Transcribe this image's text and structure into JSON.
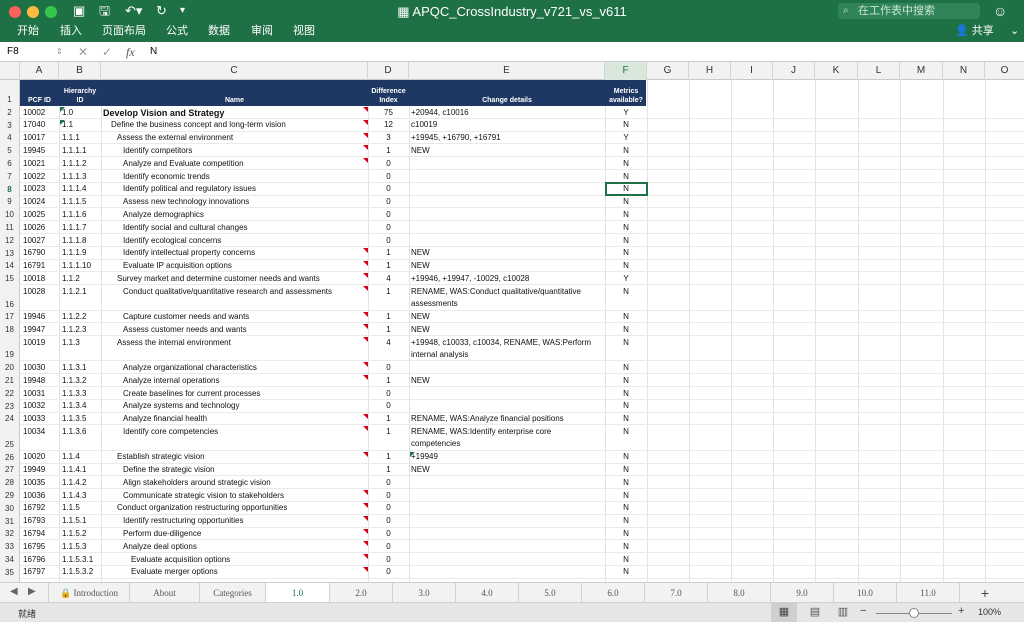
{
  "window": {
    "title": "APQC_CrossIndustry_v721_vs_v611",
    "search_placeholder": "在工作表中搜索",
    "share_label": "共享"
  },
  "menu": [
    "开始",
    "插入",
    "页面布局",
    "公式",
    "数据",
    "审阅",
    "视图"
  ],
  "formula_bar": {
    "cell_ref": "F8",
    "fx_label": "fx",
    "value": "N"
  },
  "columns": [
    "A",
    "B",
    "C",
    "D",
    "E",
    "F",
    "G",
    "H",
    "I",
    "J",
    "K",
    "L",
    "M",
    "N",
    "O"
  ],
  "header_row": {
    "a": "PCF ID",
    "b1": "Hierarchy",
    "b2": "ID",
    "c": "Name",
    "d1": "Difference",
    "d2": "Index",
    "e": "Change details",
    "f1": "Metrics",
    "f2": "available?"
  },
  "rows": [
    {
      "n": "2",
      "a": "10002",
      "b": "1.0",
      "c": "Develop Vision and Strategy",
      "d": "75",
      "e": "+20944, c10016",
      "f": "Y"
    },
    {
      "n": "3",
      "a": "17040",
      "b": "1.1",
      "c": "Define the business concept and long-term vision",
      "d": "12",
      "e": "c10019",
      "f": "N"
    },
    {
      "n": "4",
      "a": "10017",
      "b": "1.1.1",
      "c": "Assess the external environment",
      "d": "3",
      "e": "+19945, +16790, +16791",
      "f": "Y"
    },
    {
      "n": "5",
      "a": "19945",
      "b": "1.1.1.1",
      "c": "Identify competitors",
      "d": "1",
      "e": "NEW",
      "f": "N"
    },
    {
      "n": "6",
      "a": "10021",
      "b": "1.1.1.2",
      "c": "Analyze and Evaluate competition",
      "d": "0",
      "e": "",
      "f": "N"
    },
    {
      "n": "7",
      "a": "10022",
      "b": "1.1.1.3",
      "c": "Identify economic trends",
      "d": "0",
      "e": "",
      "f": "N"
    },
    {
      "n": "8",
      "a": "10023",
      "b": "1.1.1.4",
      "c": "Identify political and regulatory issues",
      "d": "0",
      "e": "",
      "f": "N"
    },
    {
      "n": "9",
      "a": "10024",
      "b": "1.1.1.5",
      "c": "Assess new technology innovations",
      "d": "0",
      "e": "",
      "f": "N"
    },
    {
      "n": "10",
      "a": "10025",
      "b": "1.1.1.6",
      "c": "Analyze demographics",
      "d": "0",
      "e": "",
      "f": "N"
    },
    {
      "n": "11",
      "a": "10026",
      "b": "1.1.1.7",
      "c": "Identify social and cultural changes",
      "d": "0",
      "e": "",
      "f": "N"
    },
    {
      "n": "12",
      "a": "10027",
      "b": "1.1.1.8",
      "c": "Identify ecological concerns",
      "d": "0",
      "e": "",
      "f": "N"
    },
    {
      "n": "13",
      "a": "16790",
      "b": "1.1.1.9",
      "c": "Identify intellectual property concerns",
      "d": "1",
      "e": "NEW",
      "f": "N"
    },
    {
      "n": "14",
      "a": "16791",
      "b": "1.1.1.10",
      "c": "Evaluate IP acquisition options",
      "d": "1",
      "e": "NEW",
      "f": "N"
    },
    {
      "n": "15",
      "a": "10018",
      "b": "1.1.2",
      "c": "Survey market and determine customer needs and wants",
      "d": "4",
      "e": "+19946, +19947, -10029, c10028",
      "f": "Y"
    },
    {
      "n": "16",
      "a": "10028",
      "b": "1.1.2.1",
      "c": "Conduct qualitative/quantitative research and assessments",
      "d": "1",
      "e": "RENAME, WAS:Conduct qualitative/quantitative",
      "e2": "assessments",
      "f": "N"
    },
    {
      "n": "17",
      "a": "19946",
      "b": "1.1.2.2",
      "c": "Capture customer needs and wants",
      "d": "1",
      "e": "NEW",
      "f": "N"
    },
    {
      "n": "18",
      "a": "19947",
      "b": "1.1.2.3",
      "c": "Assess customer needs and wants",
      "d": "1",
      "e": "NEW",
      "f": "N"
    },
    {
      "n": "19",
      "a": "10019",
      "b": "1.1.3",
      "c": "Assess the internal environment",
      "d": "4",
      "e": "+19948, c10033, c10034, RENAME, WAS:Perform",
      "e2": "internal analysis",
      "f": "N"
    },
    {
      "n": "20",
      "a": "10030",
      "b": "1.1.3.1",
      "c": "Analyze organizational characteristics",
      "d": "0",
      "e": "",
      "f": "N"
    },
    {
      "n": "21",
      "a": "19948",
      "b": "1.1.3.2",
      "c": "Analyze internal operations",
      "d": "1",
      "e": "NEW",
      "f": "N"
    },
    {
      "n": "22",
      "a": "10031",
      "b": "1.1.3.3",
      "c": "Create baselines for current processes",
      "d": "0",
      "e": "",
      "f": "N"
    },
    {
      "n": "23",
      "a": "10032",
      "b": "1.1.3.4",
      "c": "Analyze systems and technology",
      "d": "0",
      "e": "",
      "f": "N"
    },
    {
      "n": "24",
      "a": "10033",
      "b": "1.1.3.5",
      "c": "Analyze financial health",
      "d": "1",
      "e": "RENAME, WAS:Analyze financial positions",
      "f": "N"
    },
    {
      "n": "25",
      "a": "10034",
      "b": "1.1.3.6",
      "c": "Identify core competencies",
      "d": "1",
      "e": "RENAME, WAS:Identify enterprise core",
      "e2": "competencies",
      "f": "N"
    },
    {
      "n": "26",
      "a": "10020",
      "b": "1.1.4",
      "c": "Establish strategic vision",
      "d": "1",
      "e": "+19949",
      "f": "N"
    },
    {
      "n": "27",
      "a": "19949",
      "b": "1.1.4.1",
      "c": "Define the strategic vision",
      "d": "1",
      "e": "NEW",
      "f": "N"
    },
    {
      "n": "28",
      "a": "10035",
      "b": "1.1.4.2",
      "c": "Align stakeholders around strategic vision",
      "d": "0",
      "e": "",
      "f": "N"
    },
    {
      "n": "29",
      "a": "10036",
      "b": "1.1.4.3",
      "c": "Communicate strategic vision to stakeholders",
      "d": "0",
      "e": "",
      "f": "N"
    },
    {
      "n": "30",
      "a": "16792",
      "b": "1.1.5",
      "c": "Conduct organization restructuring opportunities",
      "d": "0",
      "e": "",
      "f": "N"
    },
    {
      "n": "31",
      "a": "16793",
      "b": "1.1.5.1",
      "c": "Identify restructuring opportunities",
      "d": "0",
      "e": "",
      "f": "N"
    },
    {
      "n": "32",
      "a": "16794",
      "b": "1.1.5.2",
      "c": "Perform due-diligence",
      "d": "0",
      "e": "",
      "f": "N"
    },
    {
      "n": "33",
      "a": "16795",
      "b": "1.1.5.3",
      "c": "Analyze deal options",
      "d": "0",
      "e": "",
      "f": "N"
    },
    {
      "n": "34",
      "a": "16796",
      "b": "1.1.5.3.1",
      "c": "Evaluate acquisition options",
      "d": "0",
      "e": "",
      "f": "N"
    },
    {
      "n": "35",
      "a": "16797",
      "b": "1.1.5.3.2",
      "c": "Evaluate merger options",
      "d": "0",
      "e": "",
      "f": "N"
    }
  ],
  "sheet_tabs": [
    "Introduction",
    "About",
    "Categories",
    "1.0",
    "2.0",
    "3.0",
    "4.0",
    "5.0",
    "6.0",
    "7.0",
    "8.0",
    "9.0",
    "10.0",
    "11.0"
  ],
  "add_sheet_label": "+",
  "status": {
    "ready": "就绪",
    "zoom": "100%"
  }
}
